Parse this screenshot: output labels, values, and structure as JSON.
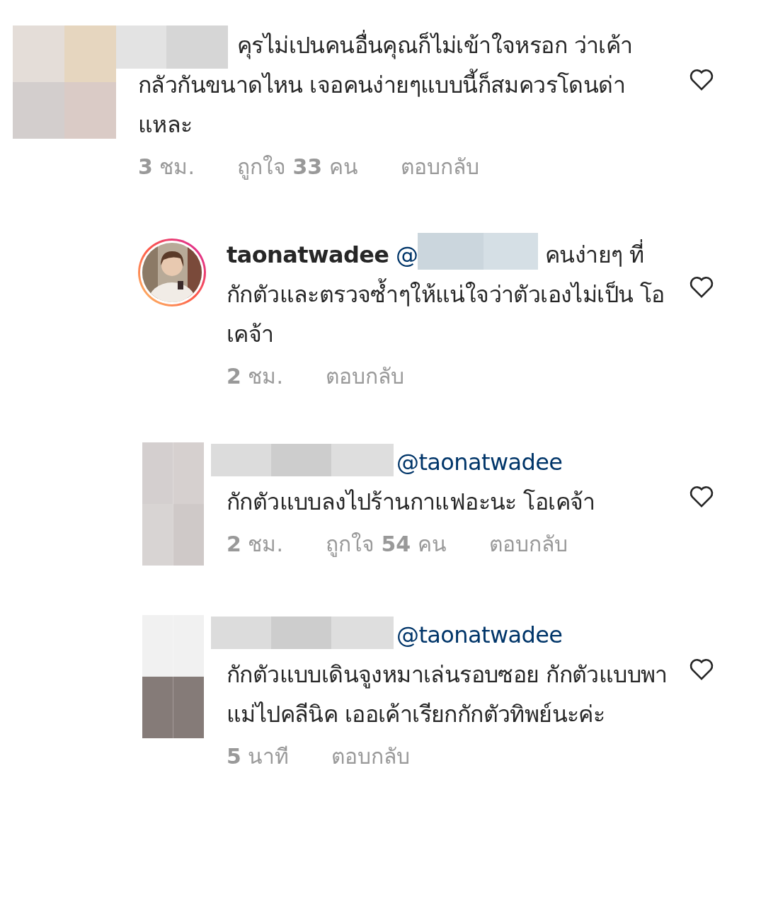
{
  "comments": [
    {
      "avatar": {
        "kind": "mosaic"
      },
      "author_redacted": true,
      "body": "คุรไม่เปนคนอื่นคุณก็ไม่เข้าใจหรอก ว่าเค้ากลัวกันขนาดไหน เจอคนง่ายๆแบบนี้ก็สมควรโดนด่าแหละ",
      "time": "**3** ชม.",
      "likes": "ถูกใจ **33** คน",
      "reply": "ตอบกลับ",
      "liked": false,
      "children": [
        {
          "author": "taonatwadee",
          "author_redacted": false,
          "mention": {
            "text": "@",
            "redacted": true
          },
          "body": "คนง่ายๆ ที่กักตัวและตรวจซ้ำๆให้แน่ใจว่าตัวเองไม่เป็น โอเคจ้า",
          "time": "**2** ชม.",
          "reply": "ตอบกลับ",
          "liked": false
        },
        {
          "avatar": {
            "kind": "mosaic"
          },
          "author_redacted": true,
          "mention": {
            "text": "@taonatwadee",
            "redacted": false
          },
          "body": "กักตัวแบบลงไปร้านกาแฟอะนะ โอเคจ้า",
          "time": "**2** ชม.",
          "likes": "ถูกใจ **54** คน",
          "reply": "ตอบกลับ",
          "liked": false
        },
        {
          "avatar": {
            "kind": "mosaic"
          },
          "author_redacted": true,
          "mention": {
            "text": "@taonatwadee",
            "redacted": false
          },
          "body": "กักตัวแบบเดินจูงหมาเล่นรอบซอย กักตัวแบบพาแม่ไปคลีนิค เออเค้าเรียกกักตัวทิพย์นะค่ะ",
          "time": "**5** นาที",
          "reply": "ตอบกลับ",
          "liked": false
        }
      ]
    }
  ]
}
